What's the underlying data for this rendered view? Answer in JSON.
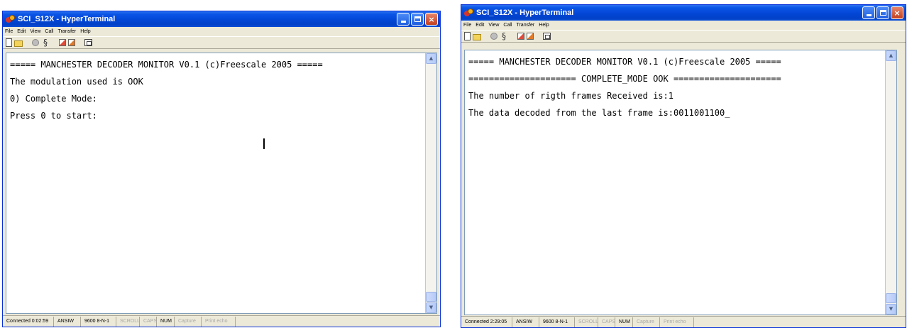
{
  "windows": [
    {
      "title": "SCI_S12X - HyperTerminal",
      "menu": [
        "File",
        "Edit",
        "View",
        "Call",
        "Transfer",
        "Help"
      ],
      "terminal_lines": [
        "===== MANCHESTER DECODER MONITOR V0.1 (c)Freescale 2005 =====",
        "The modulation used is OOK",
        "0) Complete Mode:",
        "Press 0 to start:"
      ],
      "status": {
        "connected": "Connected 0:02:59",
        "emulation": "ANSIW",
        "baud": "9600 8-N-1",
        "scroll": "SCROLL",
        "caps": "CAPS",
        "num": "NUM",
        "capture": "Capture",
        "print_echo": "Print echo"
      }
    },
    {
      "title": "SCI_S12X - HyperTerminal",
      "menu": [
        "File",
        "Edit",
        "View",
        "Call",
        "Transfer",
        "Help"
      ],
      "terminal_lines": [
        "===== MANCHESTER DECODER MONITOR V0.1 (c)Freescale 2005 =====",
        "===================== COMPLETE_MODE OOK =====================",
        "The number of rigth frames Received is:1",
        "The data decoded from the last frame is:0011001100_"
      ],
      "status": {
        "connected": "Connected 2:29:05",
        "emulation": "ANSIW",
        "baud": "9600 8-N-1",
        "scroll": "SCROLL",
        "caps": "CAPS",
        "num": "NUM",
        "capture": "Capture",
        "print_echo": "Print echo"
      }
    }
  ],
  "title_buttons": {
    "minimize": "minimize-icon",
    "maximize": "maximize-icon",
    "close": "×"
  },
  "colors": {
    "titlebar": "#0346d6",
    "window_frame": "#ece9d8",
    "terminal_bg": "#ffffff",
    "close_button": "#c2401f"
  }
}
